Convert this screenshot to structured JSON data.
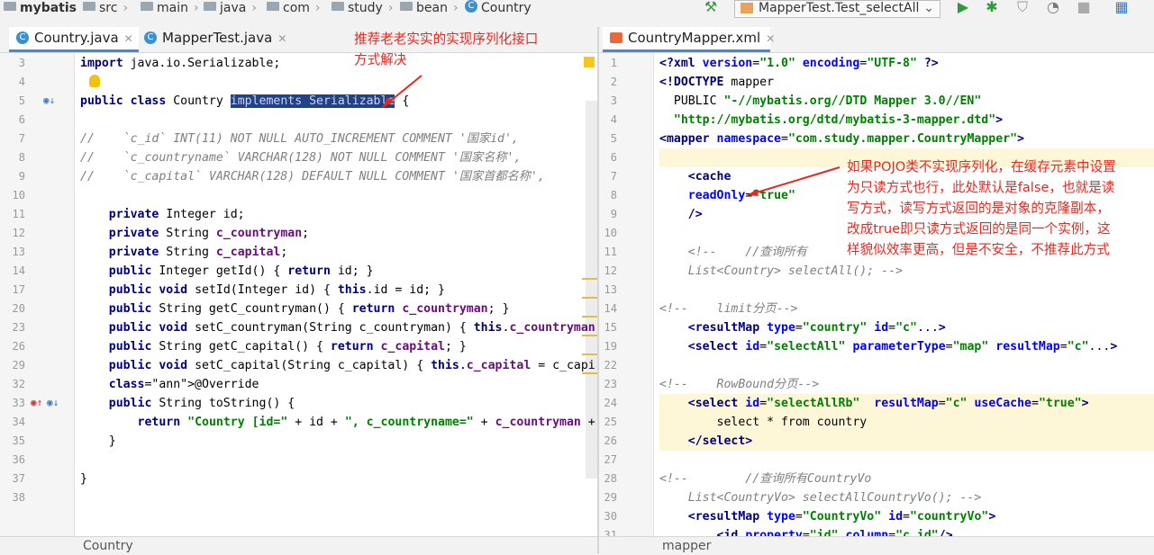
{
  "navbar": {
    "crumbs": [
      "mybatis",
      "src",
      "main",
      "java",
      "com",
      "study",
      "bean",
      "Country"
    ],
    "run_config": "MapperTest.Test_selectAll"
  },
  "left_tabs": [
    {
      "label": "Country.java",
      "active": true
    },
    {
      "label": "MapperTest.java",
      "active": false
    }
  ],
  "right_tabs": [
    {
      "label": "CountryMapper.xml",
      "active": true
    }
  ],
  "java_lines": [
    {
      "n": "3",
      "code": "import java.io.Serializable;"
    },
    {
      "n": "4",
      "code": ""
    },
    {
      "n": "5",
      "pre": "public class Country ",
      "sel": "implements Serializable",
      "post": " {"
    },
    {
      "n": "6",
      "code": ""
    },
    {
      "n": "7",
      "code": "//    `c_id` INT(11) NOT NULL AUTO_INCREMENT COMMENT '国家id',"
    },
    {
      "n": "8",
      "code": "//    `c_countryname` VARCHAR(128) NOT NULL COMMENT '国家名称',"
    },
    {
      "n": "9",
      "code": "//    `c_capital` VARCHAR(128) DEFAULT NULL COMMENT '国家首都名称',"
    },
    {
      "n": "10",
      "code": ""
    },
    {
      "n": "11",
      "code": "    private Integer id;"
    },
    {
      "n": "12",
      "code": "    private String c_countryman;"
    },
    {
      "n": "13",
      "code": "    private String c_capital;"
    },
    {
      "n": "14",
      "code": "    public Integer getId() { return id; }"
    },
    {
      "n": "17",
      "code": "    public void setId(Integer id) { this.id = id; }"
    },
    {
      "n": "20",
      "code": "    public String getC_countryman() { return c_countryman; }"
    },
    {
      "n": "23",
      "code": "    public void setC_countryman(String c_countryman) { this.c_countryman"
    },
    {
      "n": "26",
      "code": "    public String getC_capital() { return c_capital; }"
    },
    {
      "n": "29",
      "code": "    public void setC_capital(String c_capital) { this.c_capital = c_capi"
    },
    {
      "n": "32",
      "code": "    @Override"
    },
    {
      "n": "33",
      "code": "    public String toString() {"
    },
    {
      "n": "34",
      "code": "        return \"Country [id=\" + id + \", c_countryname=\" + c_countryman +"
    },
    {
      "n": "35",
      "code": "    }"
    },
    {
      "n": "36",
      "code": ""
    },
    {
      "n": "37",
      "code": "}"
    },
    {
      "n": "38",
      "code": ""
    }
  ],
  "xml_lines": [
    {
      "n": "1",
      "code": "<?xml version=\"1.0\" encoding=\"UTF-8\" ?>"
    },
    {
      "n": "2",
      "code": "<!DOCTYPE mapper"
    },
    {
      "n": "3",
      "code": "  PUBLIC \"-//mybatis.org//DTD Mapper 3.0//EN\""
    },
    {
      "n": "4",
      "code": "  \"http://mybatis.org/dtd/mybatis-3-mapper.dtd\">"
    },
    {
      "n": "5",
      "code": "<mapper namespace=\"com.study.mapper.CountryMapper\">"
    },
    {
      "n": "6",
      "code": ""
    },
    {
      "n": "7",
      "code": "    <cache"
    },
    {
      "n": "8",
      "code": "    readOnly=\"true\""
    },
    {
      "n": "9",
      "code": "    />"
    },
    {
      "n": "10",
      "code": ""
    },
    {
      "n": "11",
      "code": "    <!--    //查询所有"
    },
    {
      "n": "12",
      "code": "    List<Country> selectAll(); -->"
    },
    {
      "n": "13",
      "code": ""
    },
    {
      "n": "14",
      "code": "<!--    limit分页-->"
    },
    {
      "n": "15",
      "code": "    <resultMap type=\"country\" id=\"c\"...>"
    },
    {
      "n": "19",
      "code": "    <select id=\"selectAll\" parameterType=\"map\" resultMap=\"c\"...>"
    },
    {
      "n": "22",
      "code": ""
    },
    {
      "n": "23",
      "code": "<!--    RowBound分页-->"
    },
    {
      "n": "24",
      "code": "    <select id=\"selectAllRb\"  resultMap=\"c\" useCache=\"true\">"
    },
    {
      "n": "25",
      "code": "        select * from country"
    },
    {
      "n": "26",
      "code": "    </select>"
    },
    {
      "n": "27",
      "code": ""
    },
    {
      "n": "28",
      "code": "<!--        //查询所有CountryVo"
    },
    {
      "n": "29",
      "code": "    List<CountryVo> selectAllCountryVo(); -->"
    },
    {
      "n": "30",
      "code": "    <resultMap type=\"CountryVo\" id=\"countryVo\">"
    },
    {
      "n": "31",
      "code": "        <id property=\"id\" column=\"c_id\"/>"
    }
  ],
  "annotations": {
    "note1": [
      "推荐老老实实的实现序列化接口",
      "方式解决"
    ],
    "note2": [
      "如果POJO类不实现序列化，在缓存元素中设置",
      "为只读方式也行，此处默认是false，也就是读",
      "写方式，读写方式返回的是对象的克隆副本，",
      "改成true即只读方式返回的是同一个实例，这",
      "样貌似效率更高，但是不安全，不推荐此方式"
    ]
  },
  "status": {
    "left": "Country",
    "right": "mapper"
  }
}
